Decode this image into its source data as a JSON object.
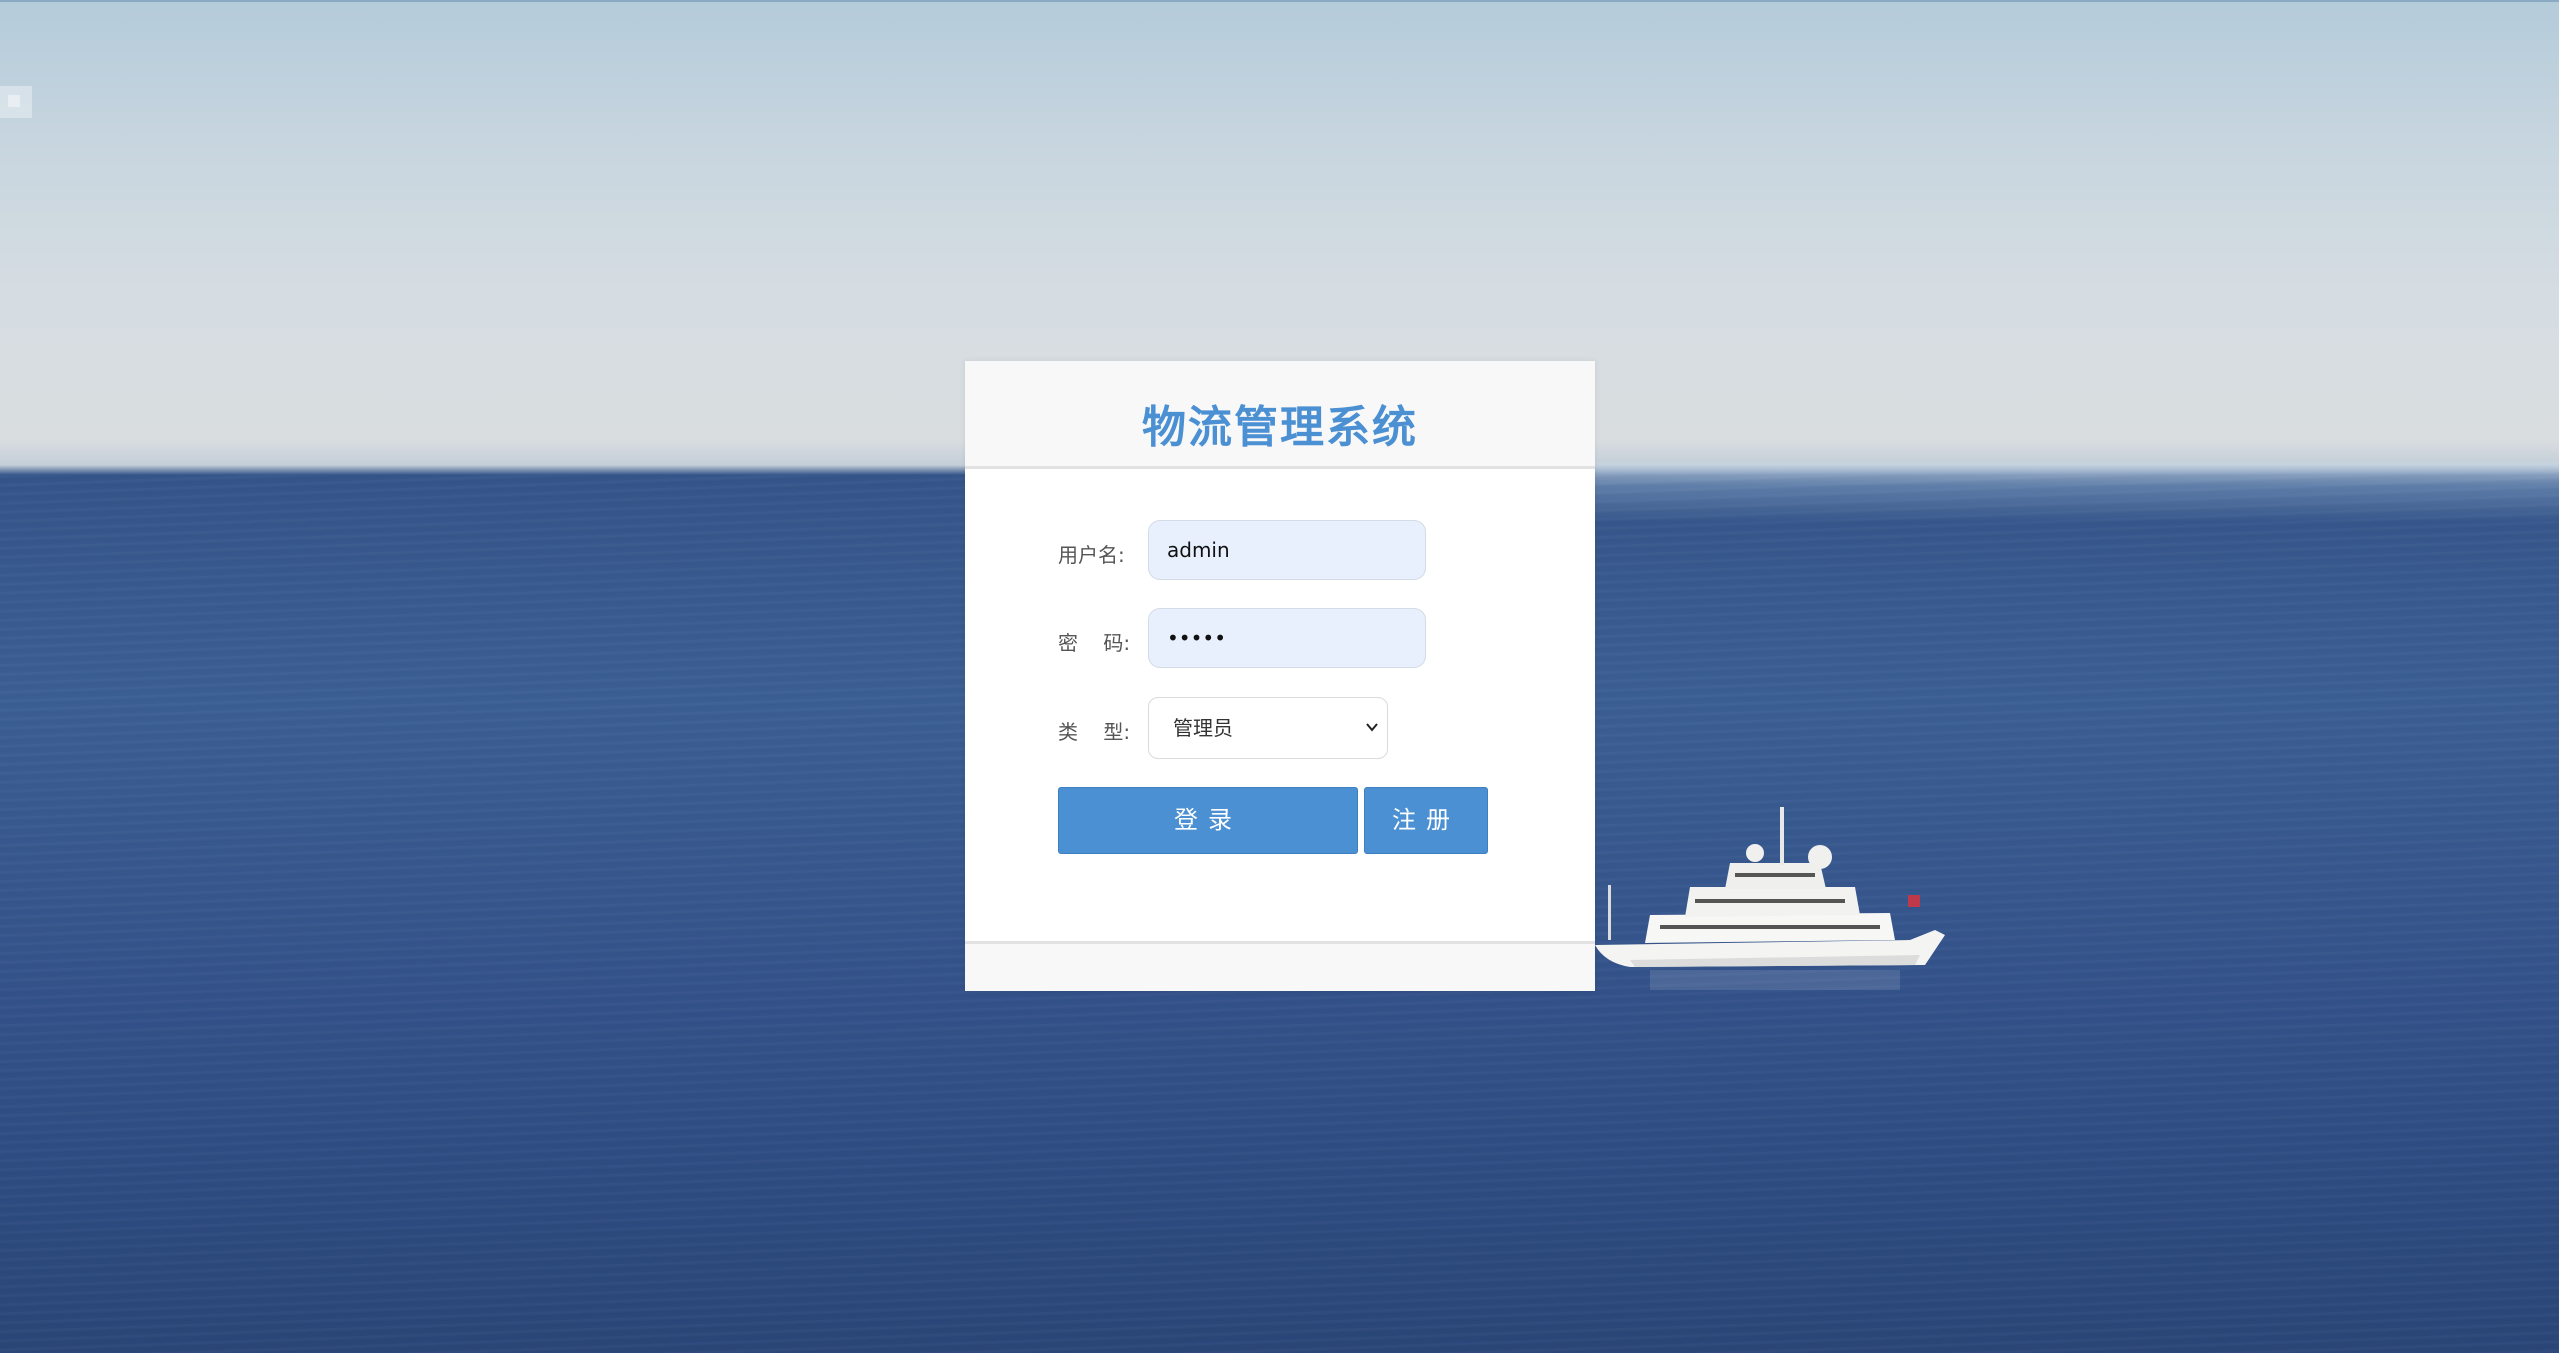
{
  "app": {
    "title": "物流管理系统"
  },
  "form": {
    "username_label": "用户名:",
    "username_value": "admin",
    "password_label": "密    码:",
    "password_value": "•••••",
    "type_label": "类    型:",
    "type_selected": "管理员",
    "type_options": [
      "管理员"
    ]
  },
  "buttons": {
    "login_label": "登录",
    "register_label": "注册"
  },
  "icons": {
    "select_arrow": "chevron-down-icon"
  },
  "colors": {
    "accent": "#4a90d3",
    "input_bg": "#e8f0fe",
    "panel_header_bg": "#f8f8f8"
  }
}
